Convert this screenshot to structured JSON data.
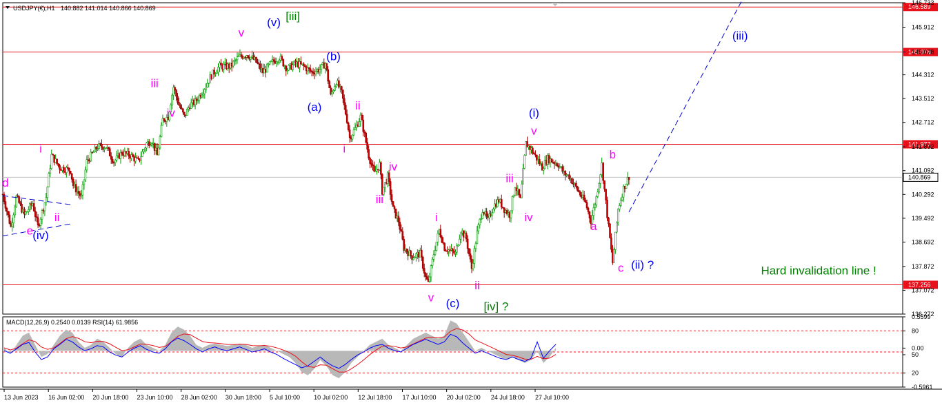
{
  "chart_data": [
    {
      "type": "candlestick",
      "title": "USDJPY(€),H1",
      "ohlc_header": {
        "open": "140.882",
        "high": "141.014",
        "low": "140.866",
        "close": "140.869"
      },
      "ylim": [
        136.272,
        146.733
      ],
      "y_ticks": [
        "146.733",
        "145.912",
        "145.078",
        "144.312",
        "143.512",
        "142.712",
        "141.892",
        "141.092",
        "140.292",
        "139.492",
        "138.692",
        "137.872",
        "137.072",
        "136.272"
      ],
      "x_ticks": [
        "13 Jun 2023",
        "16 Jun 02:00",
        "20 Jun 18:00",
        "23 Jun 10:00",
        "28 Jun 02:00",
        "30 Jun 18:00",
        "5 Jul 10:00",
        "10 Jul 02:00",
        "12 Jul 18:00",
        "17 Jul 10:00",
        "20 Jul 02:00",
        "24 Jul 18:00",
        "27 Jul 10:00"
      ],
      "price_path": [
        [
          0,
          140.3
        ],
        [
          3,
          139.2
        ],
        [
          5,
          140.2
        ],
        [
          8,
          139.6
        ],
        [
          11,
          140.0
        ],
        [
          13,
          139.2
        ],
        [
          16,
          140.2
        ],
        [
          18,
          141.6
        ],
        [
          21,
          141.2
        ],
        [
          25,
          141.1
        ],
        [
          26,
          140.6
        ],
        [
          29,
          140.2
        ],
        [
          31,
          141.4
        ],
        [
          35,
          141.9
        ],
        [
          38,
          141.9
        ],
        [
          41,
          141.4
        ],
        [
          44,
          141.7
        ],
        [
          47,
          141.6
        ],
        [
          50,
          141.4
        ],
        [
          53,
          142.0
        ],
        [
          55,
          142.1
        ],
        [
          57,
          141.6
        ],
        [
          59,
          142.8
        ],
        [
          61,
          142.9
        ],
        [
          63,
          143.9
        ],
        [
          65,
          143.3
        ],
        [
          67,
          142.9
        ],
        [
          69,
          143.3
        ],
        [
          71,
          143.4
        ],
        [
          74,
          143.8
        ],
        [
          77,
          144.3
        ],
        [
          80,
          144.6
        ],
        [
          84,
          144.6
        ],
        [
          87,
          144.9
        ],
        [
          90,
          145.0
        ],
        [
          93,
          144.8
        ],
        [
          96,
          144.4
        ],
        [
          99,
          144.7
        ],
        [
          102,
          144.9
        ],
        [
          105,
          144.5
        ],
        [
          108,
          144.7
        ],
        [
          111,
          144.6
        ],
        [
          114,
          144.4
        ],
        [
          117,
          144.5
        ],
        [
          119,
          144.7
        ],
        [
          121,
          143.6
        ],
        [
          123,
          144.1
        ],
        [
          125,
          143.7
        ],
        [
          127,
          142.8
        ],
        [
          128,
          142.2
        ],
        [
          130,
          142.5
        ],
        [
          132,
          142.9
        ],
        [
          133,
          142.5
        ],
        [
          135,
          141.6
        ],
        [
          137,
          141.0
        ],
        [
          139,
          141.3
        ],
        [
          140,
          140.4
        ],
        [
          142,
          140.9
        ],
        [
          144,
          139.8
        ],
        [
          146,
          139.4
        ],
        [
          148,
          138.5
        ],
        [
          151,
          138.2
        ],
        [
          154,
          138.3
        ],
        [
          156,
          137.5
        ],
        [
          157,
          137.3
        ],
        [
          159,
          138.3
        ],
        [
          161,
          139.1
        ],
        [
          163,
          138.5
        ],
        [
          165,
          138.4
        ],
        [
          167,
          138.3
        ],
        [
          169,
          139.1
        ],
        [
          171,
          138.8
        ],
        [
          173,
          137.8
        ],
        [
          175,
          139.0
        ],
        [
          177,
          139.8
        ],
        [
          179,
          139.4
        ],
        [
          181,
          139.9
        ],
        [
          183,
          140.1
        ],
        [
          185,
          139.8
        ],
        [
          187,
          139.6
        ],
        [
          189,
          140.6
        ],
        [
          191,
          140.1
        ],
        [
          193,
          142.0
        ],
        [
          195,
          141.8
        ],
        [
          197,
          141.5
        ],
        [
          199,
          141.2
        ],
        [
          201,
          141.5
        ],
        [
          203,
          141.4
        ],
        [
          205,
          141.3
        ],
        [
          207,
          141.0
        ],
        [
          209,
          140.9
        ],
        [
          211,
          140.6
        ],
        [
          213,
          140.3
        ],
        [
          215,
          140.0
        ],
        [
          217,
          139.4
        ],
        [
          219,
          140.2
        ],
        [
          221,
          141.3
        ],
        [
          223,
          139.6
        ],
        [
          225,
          138.0
        ],
        [
          227,
          139.8
        ],
        [
          229,
          140.5
        ],
        [
          231,
          140.9
        ]
      ],
      "horizontal_lines": [
        {
          "price": 146.589,
          "label": "146.589"
        },
        {
          "price": 145.078,
          "label": "145.078"
        },
        {
          "price": 141.977,
          "label": "141.977"
        },
        {
          "price": 137.256,
          "label": "137.256"
        }
      ],
      "current_price": {
        "price": 140.869,
        "label": "140.869"
      },
      "trendlines": [
        {
          "style": "dashed",
          "from": [
            0,
            140.25
          ],
          "to": [
            25,
            139.95
          ]
        },
        {
          "style": "dashed",
          "from": [
            0,
            138.9
          ],
          "to": [
            25,
            139.3
          ]
        },
        {
          "style": "dashed",
          "from": [
            231,
            139.7
          ],
          "to": [
            275,
            147.2
          ]
        }
      ],
      "annotations": [
        {
          "text": "d",
          "color": "#ff00ff",
          "at": [
            1,
            140.55
          ]
        },
        {
          "text": "e",
          "color": "#ff00ff",
          "at": [
            10,
            138.95
          ]
        },
        {
          "text": "(iv)",
          "color": "#0000ff",
          "at": [
            14,
            138.8
          ]
        },
        {
          "text": "i",
          "color": "#ff00ff",
          "at": [
            14,
            141.7
          ]
        },
        {
          "text": "ii",
          "color": "#ff00ff",
          "at": [
            20,
            139.4
          ]
        },
        {
          "text": "iii",
          "color": "#ff00ff",
          "at": [
            56,
            143.9
          ]
        },
        {
          "text": "iv",
          "color": "#ff00ff",
          "at": [
            62,
            142.9
          ]
        },
        {
          "text": "v",
          "color": "#ff00ff",
          "at": [
            88,
            145.6
          ]
        },
        {
          "text": "(v)",
          "color": "#0000ff",
          "at": [
            100,
            145.95
          ]
        },
        {
          "text": "[iii]",
          "color": "#008000",
          "at": [
            107,
            146.15
          ]
        },
        {
          "text": "(b)",
          "color": "#0000ff",
          "at": [
            122,
            144.8
          ]
        },
        {
          "text": "(a)",
          "color": "#0000ff",
          "at": [
            115,
            143.1
          ]
        },
        {
          "text": "ii",
          "color": "#ff00ff",
          "at": [
            131,
            143.15
          ]
        },
        {
          "text": "i",
          "color": "#ff00ff",
          "at": [
            126,
            141.7
          ]
        },
        {
          "text": "iv",
          "color": "#ff00ff",
          "at": [
            144,
            141.1
          ]
        },
        {
          "text": "iii",
          "color": "#ff00ff",
          "at": [
            139,
            140.0
          ]
        },
        {
          "text": "v",
          "color": "#ff00ff",
          "at": [
            158,
            136.7
          ]
        },
        {
          "text": "(c)",
          "color": "#0000ff",
          "at": [
            166,
            136.5
          ]
        },
        {
          "text": "i",
          "color": "#ff00ff",
          "at": [
            160,
            139.4
          ]
        },
        {
          "text": "ii",
          "color": "#ff00ff",
          "at": [
            175,
            137.1
          ]
        },
        {
          "text": "[iv] ?",
          "color": "#008000",
          "at": [
            182,
            136.4
          ]
        },
        {
          "text": "(i)",
          "color": "#0000ff",
          "at": [
            196,
            142.9
          ]
        },
        {
          "text": "v",
          "color": "#ff00ff",
          "at": [
            196,
            142.3
          ]
        },
        {
          "text": "iii",
          "color": "#ff00ff",
          "at": [
            187,
            140.7
          ]
        },
        {
          "text": "iv",
          "color": "#ff00ff",
          "at": [
            194,
            139.4
          ]
        },
        {
          "text": "b",
          "color": "#ff00ff",
          "at": [
            225,
            141.5
          ]
        },
        {
          "text": "a",
          "color": "#ff00ff",
          "at": [
            218,
            139.1
          ]
        },
        {
          "text": "c",
          "color": "#ff00ff",
          "at": [
            228,
            137.7
          ]
        },
        {
          "text": "(ii) ?",
          "color": "#0000ff",
          "at": [
            236,
            137.8
          ]
        },
        {
          "text": "(iii)",
          "color": "#0000ff",
          "at": [
            272,
            145.5
          ]
        },
        {
          "text": "Hard invalidation line !",
          "color": "#008000",
          "at": [
            301,
            137.6
          ]
        }
      ]
    },
    {
      "type": "line",
      "title": "MACD(12,26,9) 0.2540 0.0139 RSI(14) 61.9856",
      "macd_ylim": [
        -0.5961,
        0.5599
      ],
      "rsi_levels": [
        80,
        50,
        20
      ],
      "y_ticks": [
        "0.5599",
        "80",
        "0.00",
        "50",
        "20",
        "-0.5961"
      ],
      "series": [
        {
          "values": [
            0.05,
            -0.05,
            0.1,
            0.25,
            0.3,
            0.1,
            -0.1,
            -0.05,
            0.1,
            0.25,
            0.35,
            0.3,
            0.15,
            0.05,
            0.1,
            0.2,
            0.15,
            0.05,
            -0.05,
            -0.1,
            0.05,
            0.15,
            0.2,
            0.1,
            0.05,
            0.0,
            0.1,
            0.3,
            0.4,
            0.35,
            0.25,
            0.1,
            0.05,
            0.1,
            0.12,
            0.1,
            0.08,
            0.1,
            0.12,
            0.1,
            0.05,
            0.08,
            0.1,
            0.05,
            0.0,
            -0.05,
            -0.1,
            -0.2,
            -0.35,
            -0.4,
            -0.3,
            -0.15,
            -0.25,
            -0.4,
            -0.45,
            -0.35,
            -0.2,
            -0.1,
            0.0,
            0.1,
            0.15,
            0.2,
            0.1,
            0.05,
            0.0,
            0.1,
            0.2,
            0.25,
            0.3,
            0.25,
            0.2,
            0.25,
            0.5,
            0.45,
            0.3,
            0.15,
            0.0,
            0.05,
            0.0,
            -0.05,
            -0.1,
            -0.15,
            -0.1,
            -0.15,
            -0.2,
            -0.15,
            0.0,
            -0.2,
            -0.1,
            0.05
          ]
        },
        {
          "values": [
            0.52,
            0.48,
            0.55,
            0.62,
            0.65,
            0.5,
            0.38,
            0.42,
            0.55,
            0.62,
            0.7,
            0.66,
            0.58,
            0.52,
            0.55,
            0.6,
            0.58,
            0.5,
            0.45,
            0.42,
            0.5,
            0.56,
            0.6,
            0.54,
            0.5,
            0.48,
            0.55,
            0.66,
            0.72,
            0.68,
            0.62,
            0.55,
            0.5,
            0.55,
            0.58,
            0.54,
            0.52,
            0.55,
            0.58,
            0.54,
            0.5,
            0.52,
            0.55,
            0.5,
            0.46,
            0.4,
            0.35,
            0.3,
            0.25,
            0.28,
            0.35,
            0.42,
            0.34,
            0.28,
            0.24,
            0.3,
            0.38,
            0.45,
            0.5,
            0.56,
            0.6,
            0.62,
            0.56,
            0.52,
            0.5,
            0.56,
            0.62,
            0.66,
            0.7,
            0.66,
            0.62,
            0.66,
            0.78,
            0.74,
            0.64,
            0.56,
            0.48,
            0.52,
            0.48,
            0.44,
            0.4,
            0.38,
            0.42,
            0.38,
            0.35,
            0.4,
            0.66,
            0.4,
            0.52,
            0.62
          ]
        }
      ]
    }
  ]
}
